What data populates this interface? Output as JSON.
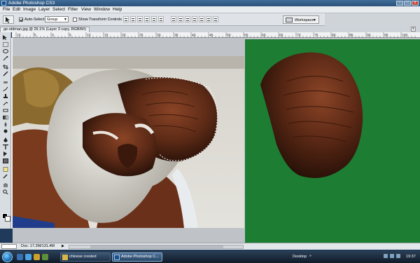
{
  "window": {
    "title": "Adobe Photoshop CS3",
    "buttons": {
      "minimize": "–",
      "maximize": "□",
      "close": "x"
    }
  },
  "menu": [
    "File",
    "Edit",
    "Image",
    "Layer",
    "Select",
    "Filter",
    "View",
    "Window",
    "Help"
  ],
  "options_bar": {
    "auto_select_label": "Auto-Select:",
    "auto_select_checked": true,
    "auto_select_value": "Group",
    "transform_controls_label": "Show Transform Controls",
    "transform_controls_checked": false,
    "workspace_label": "Workspace"
  },
  "document": {
    "tab_title": "ge-oldman.jpg @ 26.1% (Layer 3 copy, RGB/8#)",
    "close_label": "x"
  },
  "rulers": {
    "top_numbers": [
      "10",
      "5",
      "0",
      "5",
      "10",
      "15",
      "20",
      "25",
      "30",
      "35",
      "40",
      "45",
      "50",
      "55",
      "60",
      "65",
      "70",
      "75",
      "80",
      "85",
      "90",
      "95",
      "100"
    ]
  },
  "status_bar": {
    "doc_info": "Doc: 17.2M/131.4M",
    "arrow": "▶"
  },
  "taskbar": {
    "buttons": [
      {
        "label": "chinese crested",
        "active": false
      },
      {
        "label": "Adobe Photoshop C...",
        "active": true
      }
    ],
    "tray_label": "Desktop",
    "tray_arrows": "»",
    "clock": "19:37"
  },
  "colors": {
    "green_background": "#1d7d33",
    "taskbar": "#1b2a3c",
    "titlebar": "#2f5a85"
  },
  "icons": [
    "move-tool-icon",
    "marquee-tool-icon",
    "lasso-tool-icon",
    "magic-wand-icon",
    "crop-icon",
    "brush-icon",
    "eraser-icon",
    "type-tool-icon",
    "hand-tool-icon",
    "zoom-tool-icon",
    "start-orb-icon"
  ]
}
